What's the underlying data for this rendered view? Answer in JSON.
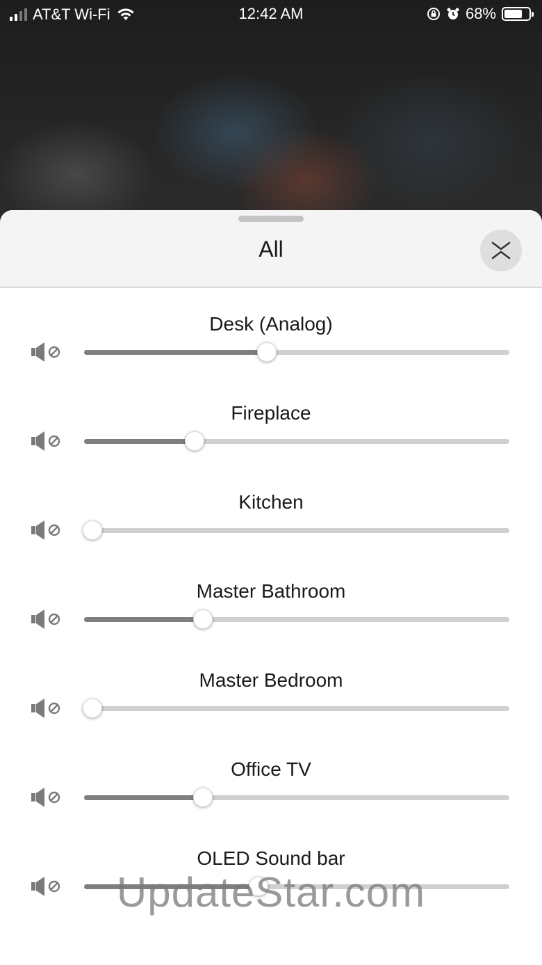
{
  "status_bar": {
    "carrier": "AT&T Wi-Fi",
    "time": "12:42 AM",
    "battery_percent": "68%",
    "battery_level": 0.68
  },
  "sheet": {
    "title": "All",
    "collapse_icon": "chevrons-collapse-icon"
  },
  "rooms": [
    {
      "name": "Desk (Analog)",
      "volume": 0.43,
      "mute_icon": "speaker-mute-icon"
    },
    {
      "name": "Fireplace",
      "volume": 0.26,
      "mute_icon": "speaker-mute-icon"
    },
    {
      "name": "Kitchen",
      "volume": 0.02,
      "mute_icon": "speaker-mute-icon"
    },
    {
      "name": "Master Bathroom",
      "volume": 0.28,
      "mute_icon": "speaker-mute-icon"
    },
    {
      "name": "Master Bedroom",
      "volume": 0.02,
      "mute_icon": "speaker-mute-icon"
    },
    {
      "name": "Office TV",
      "volume": 0.28,
      "mute_icon": "speaker-mute-icon"
    },
    {
      "name": "OLED Sound bar",
      "volume": 0.41,
      "mute_icon": "speaker-mute-icon"
    }
  ],
  "watermark": "UpdateStar.com"
}
